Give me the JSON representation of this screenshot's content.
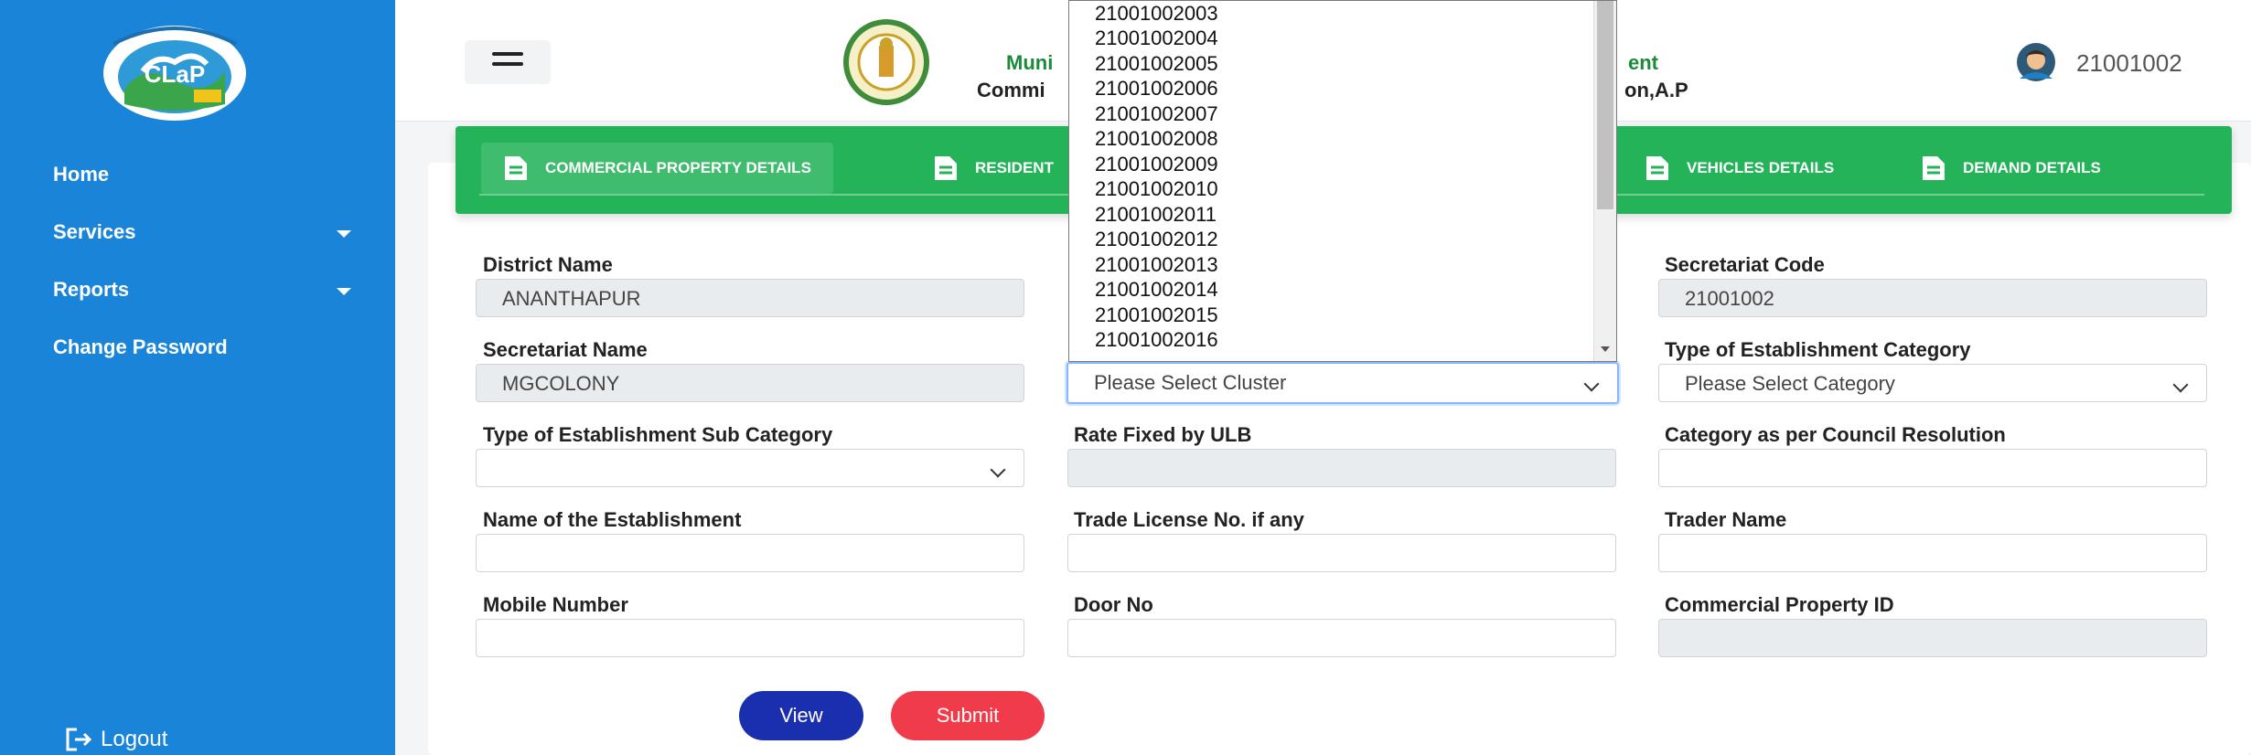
{
  "sidebar": {
    "logo_text": "CLaP",
    "items": [
      {
        "label": "Home"
      },
      {
        "label": "Services"
      },
      {
        "label": "Reports"
      },
      {
        "label": "Change Password"
      }
    ],
    "logout_label": "Logout"
  },
  "header": {
    "title_line1_left": "Muni",
    "title_line1_right": "ent",
    "title_line2_left": "Commi",
    "title_line2_right": "on,A.P",
    "user_id": "21001002"
  },
  "tabs": [
    {
      "label": "COMMERCIAL PROPERTY DETAILS"
    },
    {
      "label": "RESIDENT"
    },
    {
      "label": "VEHICLES DETAILS"
    },
    {
      "label": "DEMAND DETAILS"
    }
  ],
  "form": {
    "district_name": {
      "label": "District Name",
      "value": "ANANTHAPUR"
    },
    "secretariat_code": {
      "label": "Secretariat Code",
      "value": "21001002"
    },
    "secretariat_name": {
      "label": "Secretariat Name",
      "value": "MGCOLONY"
    },
    "cluster": {
      "value": "Please Select Cluster"
    },
    "establishment_category": {
      "label": "Type of Establishment Category",
      "value": "Please Select Category"
    },
    "establishment_sub_category": {
      "label": "Type of Establishment Sub Category",
      "value": ""
    },
    "rate_fixed": {
      "label": "Rate Fixed by ULB",
      "value": ""
    },
    "council_category": {
      "label": "Category as per Council Resolution",
      "value": ""
    },
    "establishment_name": {
      "label": "Name of the Establishment",
      "value": ""
    },
    "trade_license": {
      "label": "Trade License No. if any",
      "value": ""
    },
    "trader_name": {
      "label": "Trader Name",
      "value": ""
    },
    "mobile_number": {
      "label": "Mobile Number",
      "value": ""
    },
    "door_no": {
      "label": "Door No",
      "value": ""
    },
    "property_id": {
      "label": "Commercial Property ID",
      "value": ""
    }
  },
  "buttons": {
    "view": "View",
    "submit": "Submit"
  },
  "dropdown_options": [
    "21001002003",
    "21001002004",
    "21001002005",
    "21001002006",
    "21001002007",
    "21001002008",
    "21001002009",
    "21001002010",
    "21001002011",
    "21001002012",
    "21001002013",
    "21001002014",
    "21001002015",
    "21001002016"
  ],
  "colors": {
    "sidebar": "#1a84d9",
    "tabbar": "#25b35a",
    "view_button": "#1a2fae",
    "submit_button": "#ef3b4a",
    "header_green": "#1b8a3a"
  }
}
